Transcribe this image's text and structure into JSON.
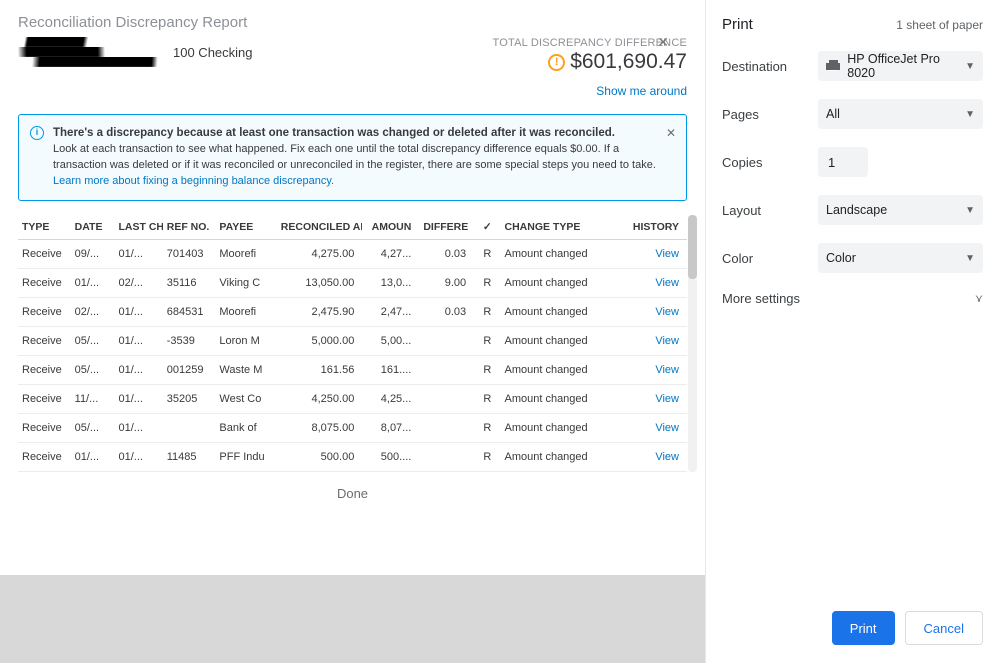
{
  "report": {
    "title": "Reconciliation Discrepancy Report",
    "account": "100 Checking",
    "discrepancy_label": "TOTAL DISCREPANCY DIFFERENCE",
    "discrepancy_amount": "$601,690.47",
    "show_me": "Show me around",
    "done": "Done"
  },
  "banner": {
    "headline": "There's a discrepancy because at least one transaction was changed or deleted after it was reconciled.",
    "body": "Look at each transaction to see what happened. Fix each one until the total discrepancy difference equals $0.00. If a transaction was deleted or if it was reconciled or unreconciled in the register, there are some special steps you need to take. ",
    "link": "Learn more about fixing a beginning balance discrepancy."
  },
  "columns": {
    "type": "TYPE",
    "date": "DATE",
    "lastch": "LAST CH",
    "ref": "REF NO.",
    "payee": "PAYEE",
    "recon": "RECONCILED AMT",
    "amount": "AMOUN",
    "diff": "DIFFERE",
    "chk": "✓",
    "change": "CHANGE TYPE",
    "history": "HISTORY"
  },
  "rows": [
    {
      "type": "Receive",
      "date": "09/...",
      "lastch": "01/...",
      "ref": "701403",
      "payee": "Moorefi",
      "recon": "4,275.00",
      "amount": "4,27...",
      "diff": "0.03",
      "chk": "R",
      "change": "Amount changed",
      "hist": "View"
    },
    {
      "type": "Receive",
      "date": "01/...",
      "lastch": "02/...",
      "ref": "35116",
      "payee": "Viking C",
      "recon": "13,050.00",
      "amount": "13,0...",
      "diff": "9.00",
      "chk": "R",
      "change": "Amount changed",
      "hist": "View"
    },
    {
      "type": "Receive",
      "date": "02/...",
      "lastch": "01/...",
      "ref": "684531",
      "payee": "Moorefi",
      "recon": "2,475.90",
      "amount": "2,47...",
      "diff": "0.03",
      "chk": "R",
      "change": "Amount changed",
      "hist": "View"
    },
    {
      "type": "Receive",
      "date": "05/...",
      "lastch": "01/...",
      "ref": "-3539",
      "payee": "Loron M",
      "recon": "5,000.00",
      "amount": "5,00...",
      "diff": "",
      "chk": "R",
      "change": "Amount changed",
      "hist": "View"
    },
    {
      "type": "Receive",
      "date": "05/...",
      "lastch": "01/...",
      "ref": "001259",
      "payee": "Waste M",
      "recon": "161.56",
      "amount": "161....",
      "diff": "",
      "chk": "R",
      "change": "Amount changed",
      "hist": "View"
    },
    {
      "type": "Receive",
      "date": "11/...",
      "lastch": "01/...",
      "ref": "35205",
      "payee": "West Co",
      "recon": "4,250.00",
      "amount": "4,25...",
      "diff": "",
      "chk": "R",
      "change": "Amount changed",
      "hist": "View"
    },
    {
      "type": "Receive",
      "date": "05/...",
      "lastch": "01/...",
      "ref": "",
      "payee": "Bank of",
      "recon": "8,075.00",
      "amount": "8,07...",
      "diff": "",
      "chk": "R",
      "change": "Amount changed",
      "hist": "View"
    },
    {
      "type": "Receive",
      "date": "01/...",
      "lastch": "01/...",
      "ref": "11485",
      "payee": "PFF Indu",
      "recon": "500.00",
      "amount": "500....",
      "diff": "",
      "chk": "R",
      "change": "Amount changed",
      "hist": "View"
    }
  ],
  "print": {
    "title": "Print",
    "sheets": "1 sheet of paper",
    "labels": {
      "dest": "Destination",
      "pages": "Pages",
      "copies": "Copies",
      "layout": "Layout",
      "color": "Color",
      "more": "More settings"
    },
    "values": {
      "dest": "HP OfficeJet Pro 8020",
      "pages": "All",
      "copies": "1",
      "layout": "Landscape",
      "color": "Color"
    },
    "buttons": {
      "print": "Print",
      "cancel": "Cancel"
    }
  }
}
